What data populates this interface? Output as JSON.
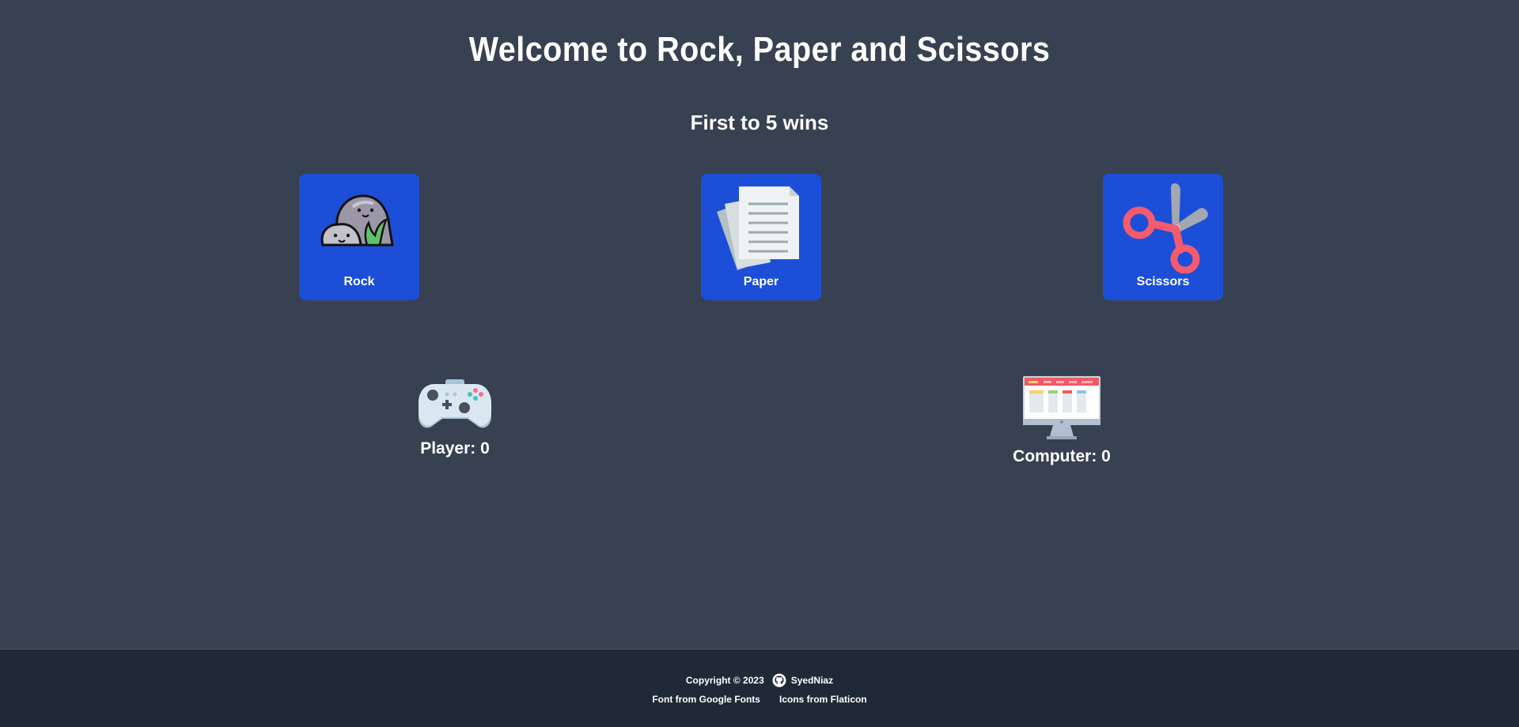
{
  "header": {
    "title": "Welcome to Rock, Paper and Scissors",
    "subtitle": "First to 5 wins"
  },
  "choices": [
    {
      "label": "Rock",
      "icon": "rock-icon"
    },
    {
      "label": "Paper",
      "icon": "paper-icon"
    },
    {
      "label": "Scissors",
      "icon": "scissors-icon"
    }
  ],
  "scores": {
    "player": {
      "text": "Player: 0",
      "icon": "gamepad-icon"
    },
    "computer": {
      "text": "Computer: 0",
      "icon": "computer-icon"
    }
  },
  "footer": {
    "copyright": "Copyright © 2023",
    "author": "SyedNiaz",
    "github_icon": "github-icon",
    "font_credit": "Font from Google Fonts",
    "icon_credit": "Icons from Flaticon"
  },
  "colors": {
    "background": "#374151",
    "button": "#1d4ed8",
    "footer": "#1f2937"
  }
}
